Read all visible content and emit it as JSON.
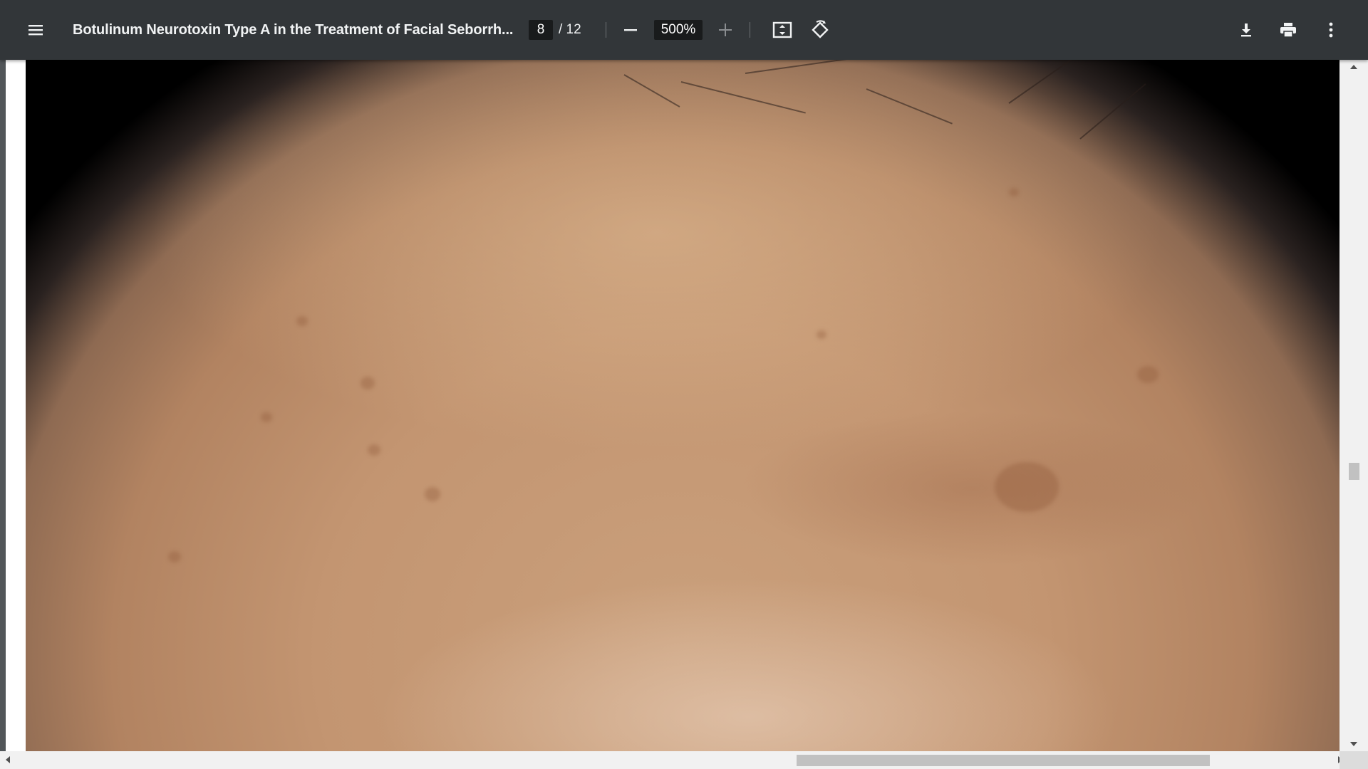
{
  "toolbar": {
    "menu_icon": "hamburger-menu-icon",
    "title": "Botulinum Neurotoxin Type A in the Treatment of Facial Seborrh...",
    "page_current": "8",
    "page_total": "/ 12",
    "zoom_value": "500%",
    "zoom_out_icon": "minus-icon",
    "zoom_in_icon": "plus-icon",
    "fit_icon": "fit-to-page-icon",
    "rotate_icon": "rotate-counterclockwise-icon",
    "download_icon": "download-icon",
    "print_icon": "print-icon",
    "more_icon": "more-vertical-icon"
  },
  "document": {
    "content": "clinical photograph of forehead skin"
  },
  "scrollbars": {
    "vertical_position": 0.52,
    "horizontal_position": 0.63
  },
  "colors": {
    "toolbar_bg": "#323639",
    "viewer_bg": "#525659",
    "input_bg": "#191b1c"
  }
}
